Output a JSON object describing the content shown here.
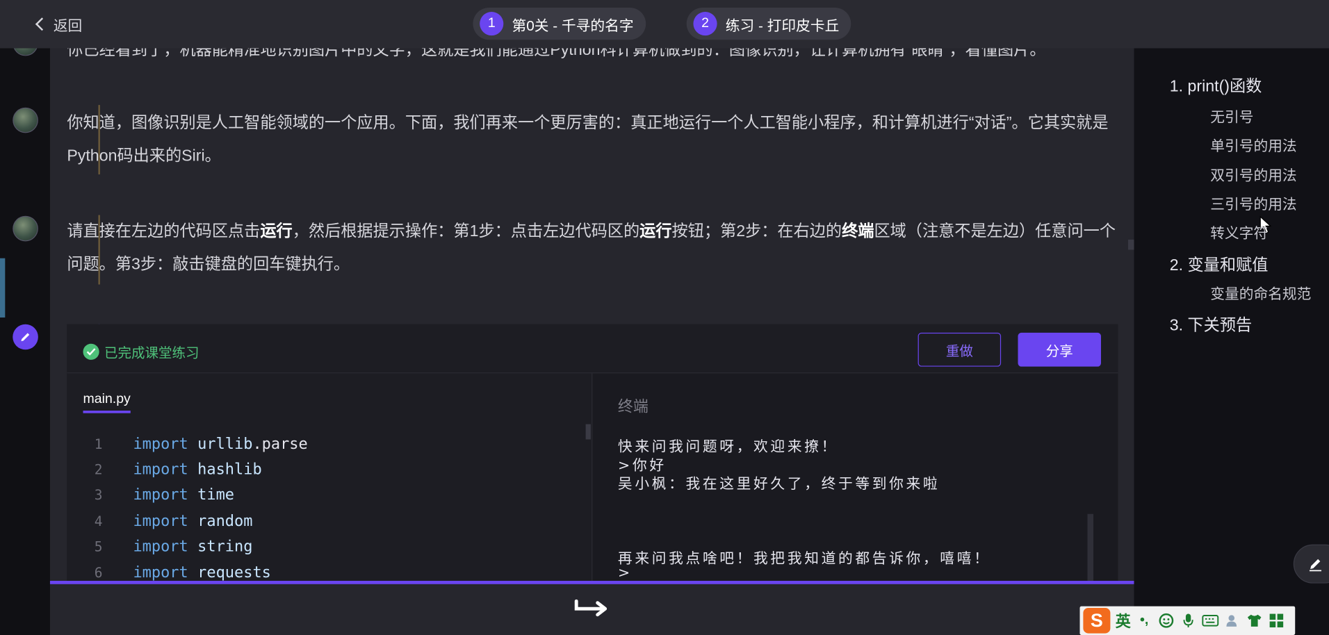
{
  "topbar": {
    "back_label": "返回",
    "levels": [
      {
        "num": "1",
        "label": "第0关 - 千寻的名字"
      },
      {
        "num": "2",
        "label": "练习 - 打印皮卡丘"
      }
    ]
  },
  "content": {
    "cut_line": "你已经看到了，机器能精准地识别图片中的文字，这就是我们能通过Python科计算机做到的：图像识别，让计算机拥有“眼睛”，看懂图片。",
    "para1": "你知道，图像识别是人工智能领域的一个应用。下面，我们再来一个更厉害的：真正地运行一个人工智能小程序，和计算机进行“对话”。它其实就是Python码出来的Siri。",
    "para2": {
      "t1": "请直接在左边的代码区点击",
      "b1": "运行",
      "t2": "，然后根据提示操作：第1步：点击左边代码区的",
      "b2": "运行",
      "t3": "按钮；第2步：在右边的",
      "b3": "终端",
      "t4": "区域（注意不是左边）任意问一个问题。第3步：敲击键盘的回车键执行。"
    }
  },
  "exercise": {
    "status": "已完成课堂练习",
    "redo_label": "重做",
    "share_label": "分享",
    "file_tab": "main.py",
    "code": [
      {
        "ln": "1",
        "kw": "import",
        "mod": "urllib",
        "tail": ".parse"
      },
      {
        "ln": "2",
        "kw": "import",
        "mod": "hashlib",
        "tail": ""
      },
      {
        "ln": "3",
        "kw": "import",
        "mod": "time",
        "tail": ""
      },
      {
        "ln": "4",
        "kw": "import",
        "mod": "random",
        "tail": ""
      },
      {
        "ln": "5",
        "kw": "import",
        "mod": "string",
        "tail": ""
      },
      {
        "ln": "6",
        "kw": "import",
        "mod": "requests",
        "tail": ""
      }
    ],
    "terminal_title": "终端",
    "terminal_lines": [
      "快来问我问题呀，欢迎来撩！",
      ">你好",
      "吴小枫：我在这里好久了，终于等到你来啦",
      "",
      "",
      "",
      "再来问我点啥吧！我把我知道的都告诉你，嘻嘻！",
      ">"
    ]
  },
  "outline": {
    "items": [
      {
        "label": "1. print()函数",
        "level": 1
      },
      {
        "label": "无引号",
        "level": 2
      },
      {
        "label": "单引号的用法",
        "level": 2
      },
      {
        "label": "双引号的用法",
        "level": 2
      },
      {
        "label": "三引号的用法",
        "level": 2
      },
      {
        "label": "转义字符",
        "level": 2
      },
      {
        "label": "2. 变量和赋值",
        "level": 1
      },
      {
        "label": "变量的命名规范",
        "level": 2
      },
      {
        "label": "3. 下关预告",
        "level": 1
      }
    ]
  },
  "ime": {
    "logo": "S",
    "mode": "英",
    "punct": "•,"
  },
  "colors": {
    "accent": "#6a45f0",
    "success": "#4fc27a",
    "bg": "#26262d"
  }
}
